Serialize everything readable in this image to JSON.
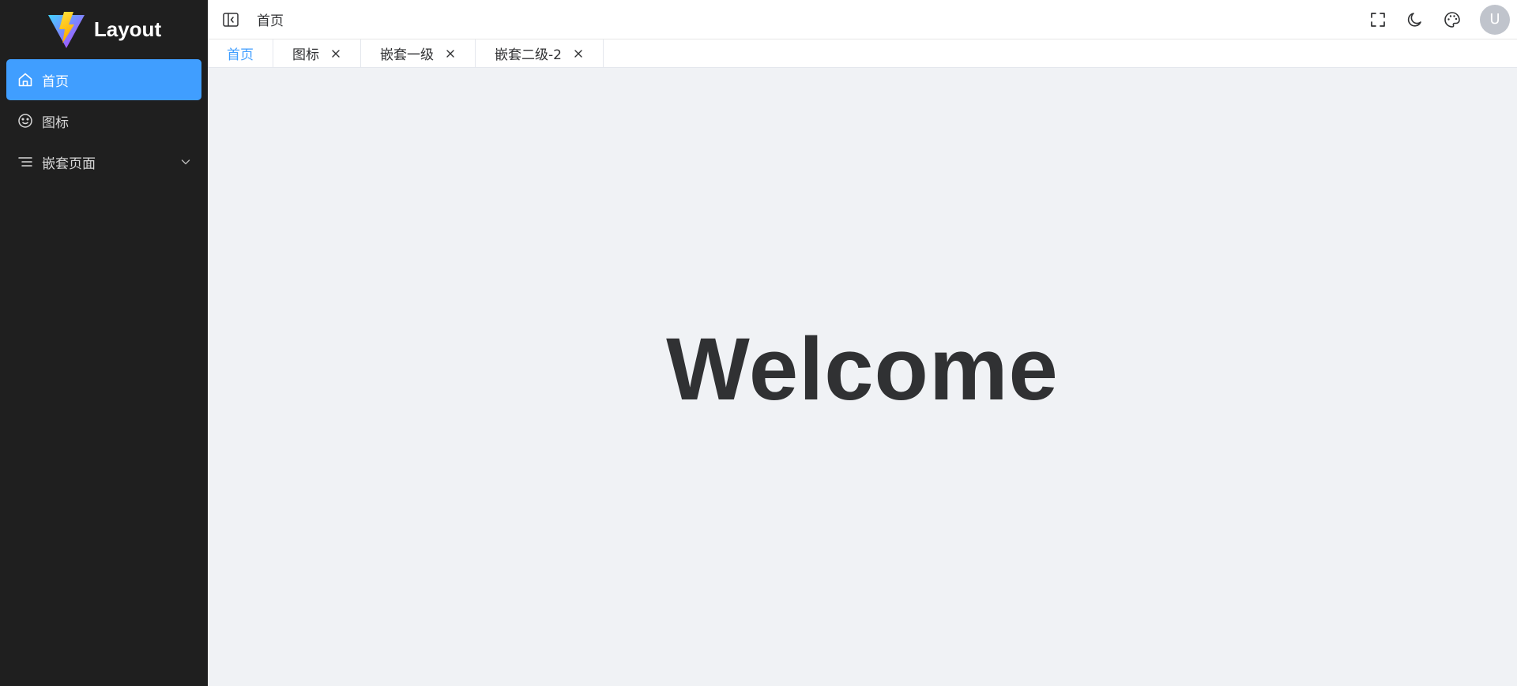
{
  "app": {
    "logo_text": "Layout",
    "accent_color": "#409eff",
    "sidebar_bg": "#1f1f1f"
  },
  "sidebar": {
    "items": [
      {
        "label": "首页",
        "icon": "home-icon",
        "active": true
      },
      {
        "label": "图标",
        "icon": "smile-icon",
        "active": false
      },
      {
        "label": "嵌套页面",
        "icon": "list-icon",
        "active": false,
        "expandable": true
      }
    ]
  },
  "header": {
    "breadcrumb": "首页",
    "icons": [
      "collapse-icon",
      "fullscreen-icon",
      "moon-icon",
      "palette-icon"
    ],
    "avatar_initial": "U"
  },
  "tabs": [
    {
      "label": "首页",
      "active": true,
      "closable": false
    },
    {
      "label": "图标",
      "active": false,
      "closable": true
    },
    {
      "label": "嵌套一级",
      "active": false,
      "closable": true
    },
    {
      "label": "嵌套二级-2",
      "active": false,
      "closable": true
    }
  ],
  "main": {
    "welcome_text": "Welcome"
  }
}
